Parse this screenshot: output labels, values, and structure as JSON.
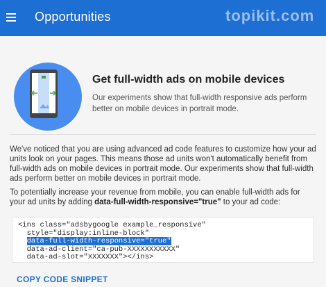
{
  "app_bar": {
    "title": "Opportunities",
    "watermark": "topikit.com",
    "color": "#1e6fd4"
  },
  "hero": {
    "icon": "mobile-full-width-ad-icon",
    "title": "Get full-width ads on mobile devices",
    "description": "Our experiments show that full-width responsive ads perform better on mobile devices in portrait mode."
  },
  "body": {
    "paragraph1": "We've noticed that you are using advanced ad code features to customize how your ad units look on your pages. This means those ad units won't automatically benefit from full-width ads on mobile devices in portrait mode. Our experiments show that full-width ads perform better on mobile devices in portrait mode.",
    "paragraph2_prefix": "To potentially increase your revenue from mobile, you can enable full-width ads for your ad units by adding ",
    "paragraph2_bold": "data-full-width-responsive=\"true\"",
    "paragraph2_suffix": " to your ad code:"
  },
  "code": {
    "line1": "<ins class=\"adsbygoogle example_responsive\"",
    "line2": "  style=\"display:inline-block\"",
    "line3_indent": "  ",
    "line3_highlight": "data-full-width-responsive=\"true\"",
    "line4": "  data-ad-client=\"ca-pub-XXXXXXXXXXX\"",
    "line5": "  data-ad-slot=\"XXXXXXX\"></ins>"
  },
  "actions": {
    "copy_label": "COPY CODE SNIPPET"
  }
}
